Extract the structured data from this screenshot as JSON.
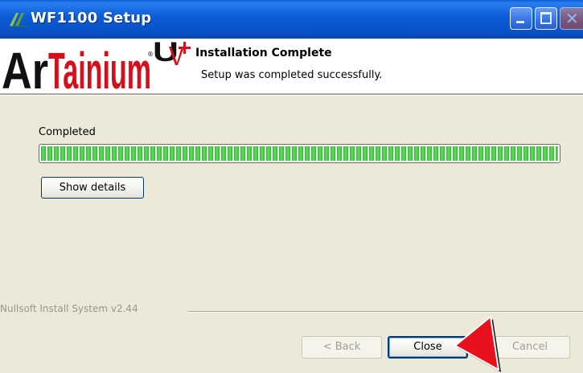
{
  "window": {
    "title": "WF1100 Setup",
    "controls": [
      "minimize",
      "maximize",
      "close"
    ]
  },
  "header": {
    "logo_text": "ArTainium",
    "logo_suffix": "UV+",
    "title": "Installation Complete",
    "subtitle": "Setup was completed successfully."
  },
  "main": {
    "status_label": "Completed",
    "progress_percent": 100,
    "show_details_label": "Show details"
  },
  "footer": {
    "branding": "Nullsoft Install System v2.44",
    "back_label": "< Back",
    "close_label": "Close",
    "cancel_label": "Cancel"
  },
  "icons": {
    "app": "app-icon",
    "pointer": "red-arrow-pointer-icon"
  },
  "colors": {
    "titlebar": "#0a52c8",
    "progress_fill": "#2ec22e",
    "logo_red": "#d4101c",
    "logo_dark": "#111111",
    "pointer_red": "#e8101c"
  }
}
